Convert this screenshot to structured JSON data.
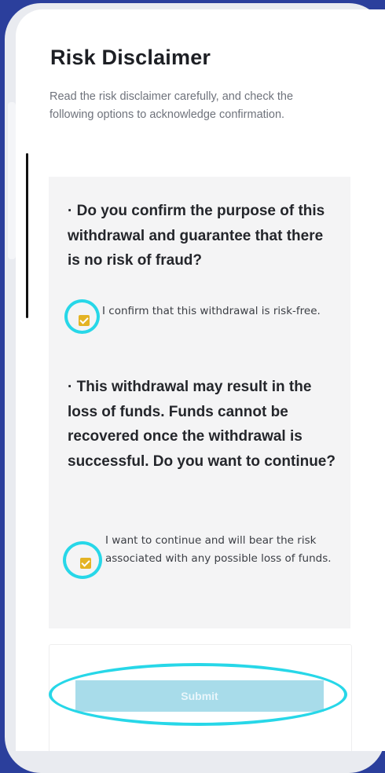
{
  "page": {
    "title": "Risk Disclaimer",
    "description": "Read the risk disclaimer carefully, and check the following options to acknowledge confirmation."
  },
  "questions": [
    {
      "text": "· Do you confirm the purpose of this withdrawal and guarantee that there is no risk of fraud?",
      "option_label": "I confirm that this withdrawal is risk-free.",
      "checked": true
    },
    {
      "text": "· This withdrawal may result in the loss of funds. Funds cannot be recovered once the withdrawal is successful. Do you want to continue?",
      "option_label": "I want to continue and will bear the risk associated with any possible loss of funds.",
      "checked": true
    }
  ],
  "submit_label": "Submit",
  "colors": {
    "background": "#2b3f9c",
    "checkbox": "#e4b324",
    "highlight_ring": "#27d7e8",
    "submit_disabled": "#a8dcea"
  }
}
